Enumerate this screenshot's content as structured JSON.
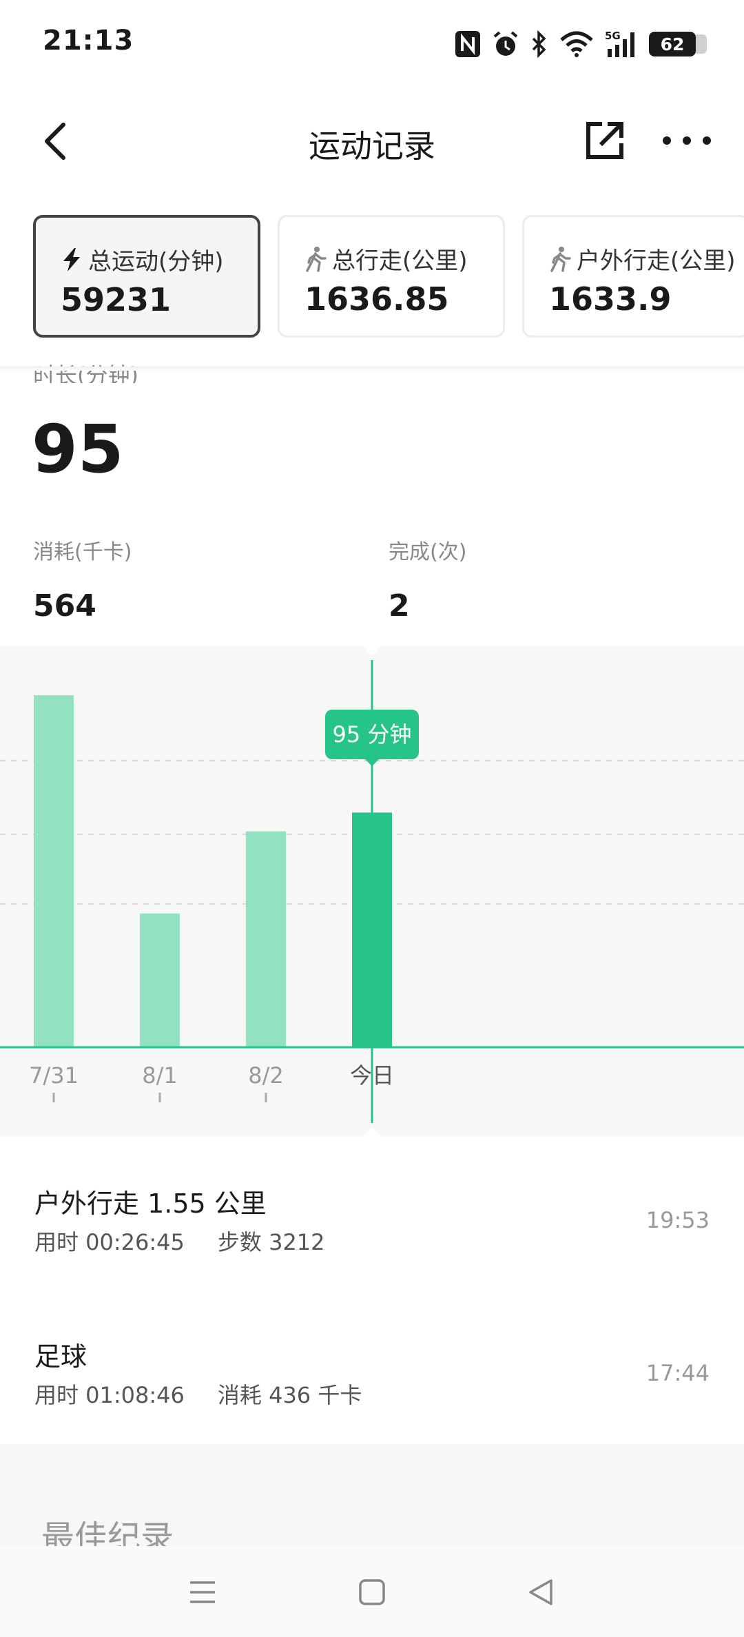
{
  "status": {
    "time": "21:13",
    "battery": "62",
    "network": "5G"
  },
  "header": {
    "title": "运动记录"
  },
  "icons": {
    "back": "chevron-left-icon",
    "share": "share-external-icon",
    "more": "more-dots-icon",
    "total": "lightning-icon",
    "walk": "walking-person-icon"
  },
  "colors": {
    "accent": "#27c489",
    "bar_light": "#92e2c2",
    "chart_bg": "#f7f7f7"
  },
  "cards": [
    {
      "label": "总运动(分钟)",
      "value": "59231",
      "active": true
    },
    {
      "label": "总行走(公里)",
      "value": "1636.85",
      "active": false
    },
    {
      "label": "户外行走(公里)",
      "value": "1633.9",
      "active": false
    }
  ],
  "summary": {
    "duration_label": "时长(分钟)",
    "duration_value": "95",
    "calories_label": "消耗(千卡)",
    "calories_value": "564",
    "completed_label": "完成(次)",
    "completed_value": "2"
  },
  "chart_data": {
    "type": "bar",
    "categories": [
      "7/31",
      "8/1",
      "8/2",
      "今日"
    ],
    "values": [
      150,
      57,
      92,
      100
    ],
    "selected_index": 3,
    "tooltip": "95 分钟",
    "ylim": [
      0,
      165
    ],
    "grid": true
  },
  "records": [
    {
      "title": "户外行走 1.55 公里",
      "detail1": "用时 00:26:45",
      "detail2": "步数 3212",
      "time": "19:53"
    },
    {
      "title": "足球",
      "detail1": "用时 01:08:46",
      "detail2": "消耗 436 千卡",
      "time": "17:44"
    }
  ],
  "best": {
    "title": "最佳纪录"
  }
}
